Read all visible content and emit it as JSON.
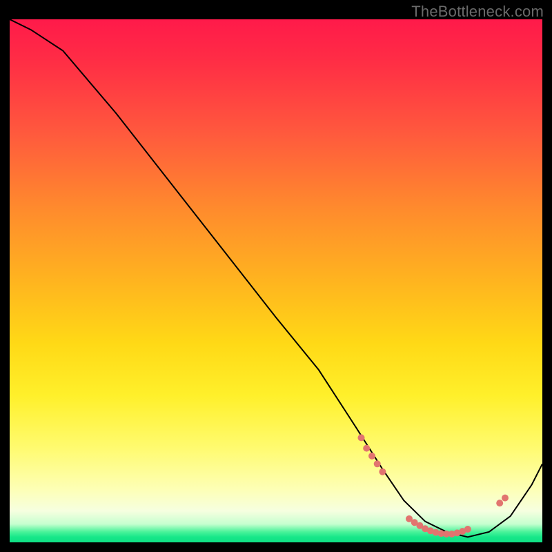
{
  "attribution": "TheBottleneck.com",
  "colors": {
    "dot_fill": "#e2746f",
    "curve_stroke": "#000000"
  },
  "chart_data": {
    "type": "line",
    "title": "",
    "xlabel": "",
    "ylabel": "",
    "xlim": [
      0,
      100
    ],
    "ylim": [
      0,
      100
    ],
    "grid": false,
    "legend": false,
    "series": [
      {
        "name": "curve",
        "x": [
          0,
          4,
          10,
          20,
          30,
          40,
          50,
          58,
          65,
          70,
          74,
          78,
          82,
          86,
          90,
          94,
          98,
          100
        ],
        "y": [
          100,
          98,
          94,
          82,
          69,
          56,
          43,
          33,
          22,
          14,
          8,
          4,
          2,
          1,
          2,
          5,
          11,
          15
        ]
      }
    ],
    "scatter": [
      {
        "name": "dots",
        "x": [
          66,
          67,
          68,
          69,
          70,
          75,
          76,
          77,
          78,
          79,
          80,
          81,
          82,
          83,
          84,
          85,
          86,
          92,
          93
        ],
        "y": [
          20,
          18,
          16.5,
          15,
          13.5,
          4.5,
          3.8,
          3.2,
          2.6,
          2.2,
          1.9,
          1.7,
          1.6,
          1.6,
          1.8,
          2.1,
          2.5,
          7.5,
          8.5
        ]
      }
    ]
  }
}
